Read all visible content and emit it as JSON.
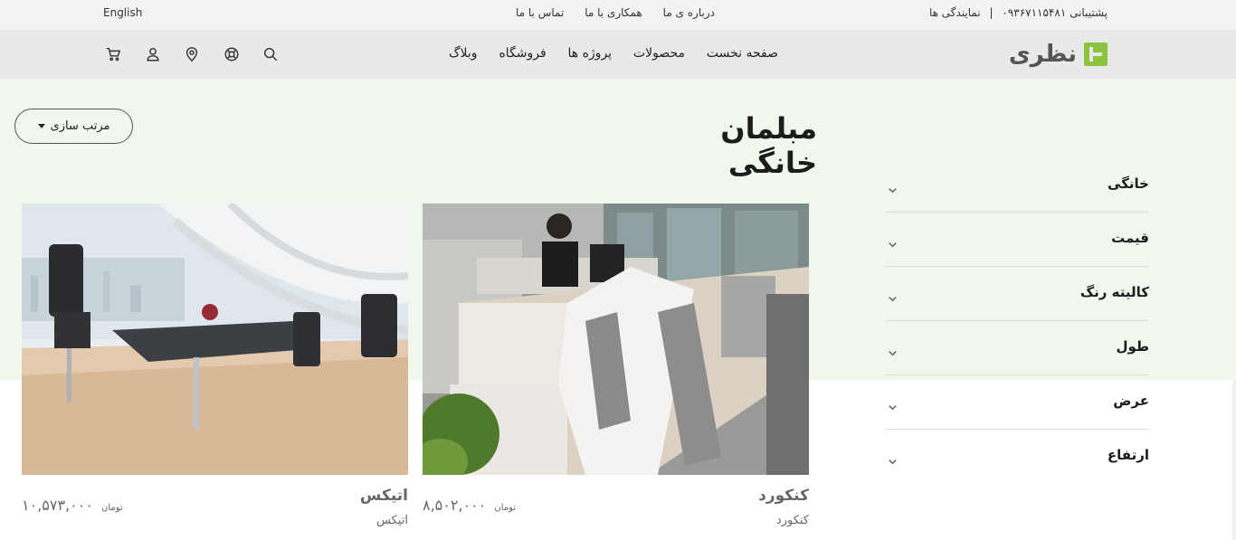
{
  "topbar": {
    "language": "English",
    "links": [
      "درباره ی ما",
      "همکاری با ما",
      "تماس با ما"
    ],
    "support_label": "پشتیبانی",
    "support_phone": "۰۹۳۶۷۱۱۵۴۸۱",
    "separator": "|",
    "dealers": "نمایندگی ها"
  },
  "header": {
    "logo_text": "نظری",
    "nav": [
      "صفحه نخست",
      "محصولات",
      "پروژه ها",
      "فروشگاه",
      "وبلاگ"
    ],
    "icons": [
      "search-icon",
      "support-icon",
      "location-icon",
      "user-icon",
      "cart-icon"
    ]
  },
  "page": {
    "title": "مبلمان خانگی",
    "sort_label": "مرتب سازی"
  },
  "filters": [
    "خانگی",
    "قیمت",
    "کالیته رنگ",
    "طول",
    "عرض",
    "ارتفاع"
  ],
  "products": [
    {
      "name": "کنکورد",
      "subtitle": "کنکورد",
      "price": "۸,۵۰۲,۰۰۰",
      "currency": "تومان"
    },
    {
      "name": "اتیکس",
      "subtitle": "اتیکس",
      "price": "۱۰,۵۷۳,۰۰۰",
      "currency": "تومان"
    }
  ],
  "colors": {
    "brand_green": "#8cc63f",
    "band_bg": "#f0f7ec",
    "header_bg": "#e9e9e9"
  }
}
